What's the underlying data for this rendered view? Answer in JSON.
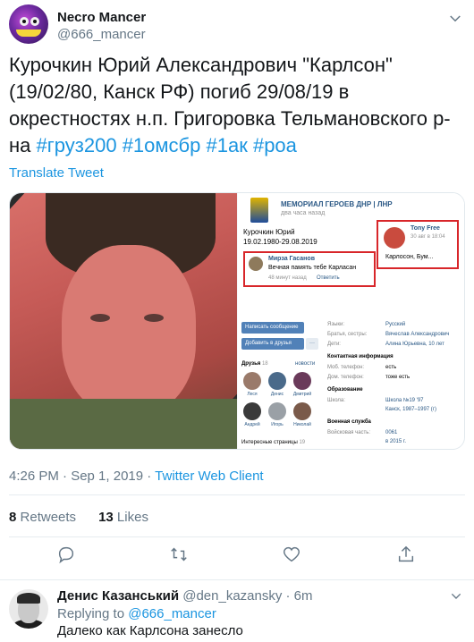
{
  "tweet": {
    "display_name": "Necro Mancer",
    "handle": "@666_mancer",
    "text_plain": "Курочкин Юрий Александрович \"Карлсон\" (19/02/80, Канск РФ) погиб 29/08/19 в окрестностях н.п. Григоровка Тельмановского р-на",
    "hashtags": [
      "#груз200",
      "#1омсбр",
      "#1ак",
      "#роа"
    ],
    "translate_label": "Translate Tweet",
    "time": "4:26 PM · Sep 1, 2019 · ",
    "client": "Twitter Web Client",
    "retweets_count": "8",
    "retweets_label": "Retweets",
    "likes_count": "13",
    "likes_label": "Likes"
  },
  "media": {
    "vk": {
      "title": "МЕМОРИАЛ ГЕРОЕВ ДНР | ЛНР",
      "subtitle": "два часа назад",
      "person_name": "Курочкин Юрий",
      "person_dates": "19.02.1980-29.08.2019",
      "comment1_name": "Мирза Гасанов",
      "comment1_text": "Вечная память тебе Карласан",
      "comment1_meta": "48 минут назад",
      "comment1_reply": "Ответить",
      "comment2_name": "Tony Free",
      "comment2_date": "30 авг в 18:04",
      "comment2_text": "Карлосон, Бум...",
      "btn_message": "Написать сообщение",
      "btn_add": "Добавить в друзья",
      "btn_more": "···",
      "friends_label": "Друзья",
      "friends_count": "18",
      "friends_new": "новости",
      "friends": [
        "Леся",
        "Денис",
        "Дмитрий",
        "Андрей",
        "Игорь",
        "Николай"
      ],
      "pages_label": "Интересные страницы",
      "pages_count": "19",
      "rows": [
        {
          "k": "Языки:",
          "v": "Русский"
        },
        {
          "k": "Братья, сестры:",
          "v": "Вячеслав Александрович"
        },
        {
          "k": "Дети:",
          "v": "Алина Юрьевна, 10 лет"
        },
        {
          "k": "Контактная информация",
          "v": ""
        },
        {
          "k": "Моб. телефон:",
          "v": "есть"
        },
        {
          "k": "Дом. телефон:",
          "v": "тоже есть"
        },
        {
          "k": "Образование",
          "v": ""
        },
        {
          "k": "Школа:",
          "v": "Школа №19 '97"
        },
        {
          "k": "",
          "v": "Канск, 1987–1997 (г)"
        },
        {
          "k": "Военная служба",
          "v": ""
        },
        {
          "k": "Войсковая часть:",
          "v": "0061"
        },
        {
          "k": "",
          "v": "в 2015 г."
        }
      ]
    }
  },
  "reply": {
    "display_name": "Денис Казанський",
    "handle": "@den_kazansky",
    "time": "· 6m",
    "replying_label": "Replying to",
    "replying_to": "@666_mancer",
    "text": "Далеко как Карлсона занесло"
  },
  "icons": {
    "reply": "reply-icon",
    "retweet": "retweet-icon",
    "like": "heart-icon",
    "share": "share-icon",
    "more": "chevron-down-icon"
  },
  "colors": {
    "link": "#1b95e0",
    "secondary": "#657786",
    "text": "#14171a",
    "highlight_box": "#d8262a"
  }
}
